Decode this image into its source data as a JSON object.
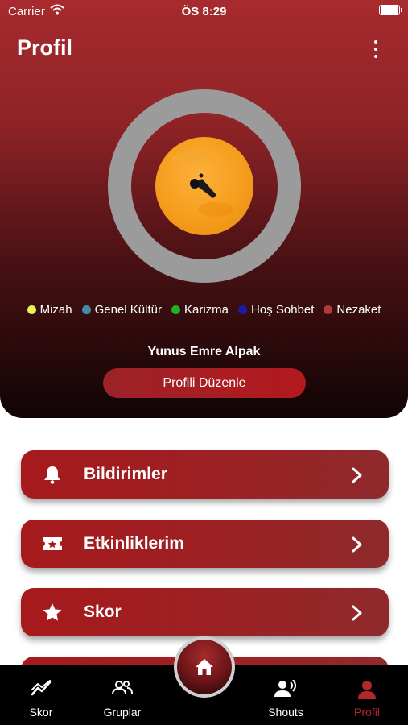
{
  "status_bar": {
    "carrier": "Carrier",
    "time": "ÖS 8:29"
  },
  "header": {
    "title": "Profil"
  },
  "profile": {
    "name": "Yunus Emre Alpak",
    "edit_button": "Profili Düzenle"
  },
  "legend": [
    {
      "label": "Mizah",
      "color": "#e7f05a"
    },
    {
      "label": "Genel Kültür",
      "color": "#3f8ea8"
    },
    {
      "label": "Karizma",
      "color": "#1fb41f"
    },
    {
      "label": "Hoş Sohbet",
      "color": "#1b1ba6"
    },
    {
      "label": "Nezaket",
      "color": "#b23a3f"
    }
  ],
  "menu": [
    {
      "label": "Bildirimler",
      "icon": "bell-icon"
    },
    {
      "label": "Etkinliklerim",
      "icon": "ticket-icon"
    },
    {
      "label": "Skor",
      "icon": "star-icon"
    }
  ],
  "tabbar": {
    "tabs": [
      {
        "label": "Skor",
        "icon": "chart-icon"
      },
      {
        "label": "Gruplar",
        "icon": "group-icon"
      },
      {
        "label": "Shouts",
        "icon": "speaker-icon"
      },
      {
        "label": "Profil",
        "icon": "person-icon",
        "active": true
      }
    ],
    "center": {
      "icon": "home-icon"
    }
  },
  "colors": {
    "accent": "#b3262a",
    "ring": "#9b9b9b",
    "avatar": "#f59b1b"
  }
}
